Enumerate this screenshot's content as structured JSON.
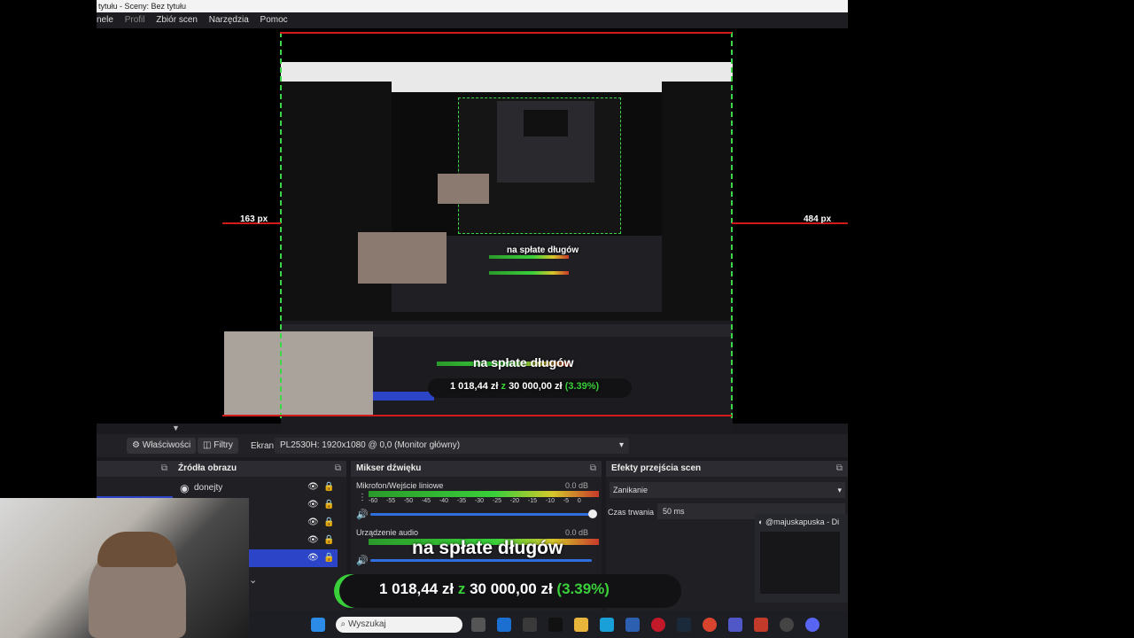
{
  "window": {
    "title": "tytułu - Sceny: Bez tytułu"
  },
  "menu": [
    "nele",
    "Profil",
    "Zbiór scen",
    "Narzędzia",
    "Pomoc"
  ],
  "preview": {
    "left_distance": "163 px",
    "right_distance": "484 px"
  },
  "toolbar": {
    "properties": "Właściwości",
    "filters": "Filtry",
    "source_label": "Ekran",
    "source_value": "PL2530H: 1920x1080 @ 0,0 (Monitor główny)"
  },
  "sources": {
    "title": "Źródła obrazu",
    "items": [
      "donejty",
      "",
      "",
      "",
      ""
    ]
  },
  "mixer": {
    "title": "Mikser dźwięku",
    "channels": [
      {
        "name": "Mikrofon/Wejście liniowe",
        "db": "0.0 dB"
      },
      {
        "name": "Urządzenie audio",
        "db": "0.0 dB"
      }
    ],
    "scale": [
      "-60",
      "-55",
      "-50",
      "-45",
      "-40",
      "-35",
      "-30",
      "-25",
      "-20",
      "-15",
      "-10",
      "-5",
      "0"
    ]
  },
  "transitions": {
    "title": "Efekty przejścia scen",
    "type": "Zanikanie",
    "duration_label": "Czas trwania",
    "duration_value": "50 ms"
  },
  "overlay": {
    "banner": "na spłate długów",
    "goal_amount": "1 018,44 zł",
    "goal_of": "z",
    "goal_target": "30 000,00 zł",
    "goal_percent": "(3.39%)"
  },
  "discord": {
    "user": "@majuskapuska - Di"
  },
  "taskbar": {
    "search_placeholder": "Wyszukaj"
  }
}
